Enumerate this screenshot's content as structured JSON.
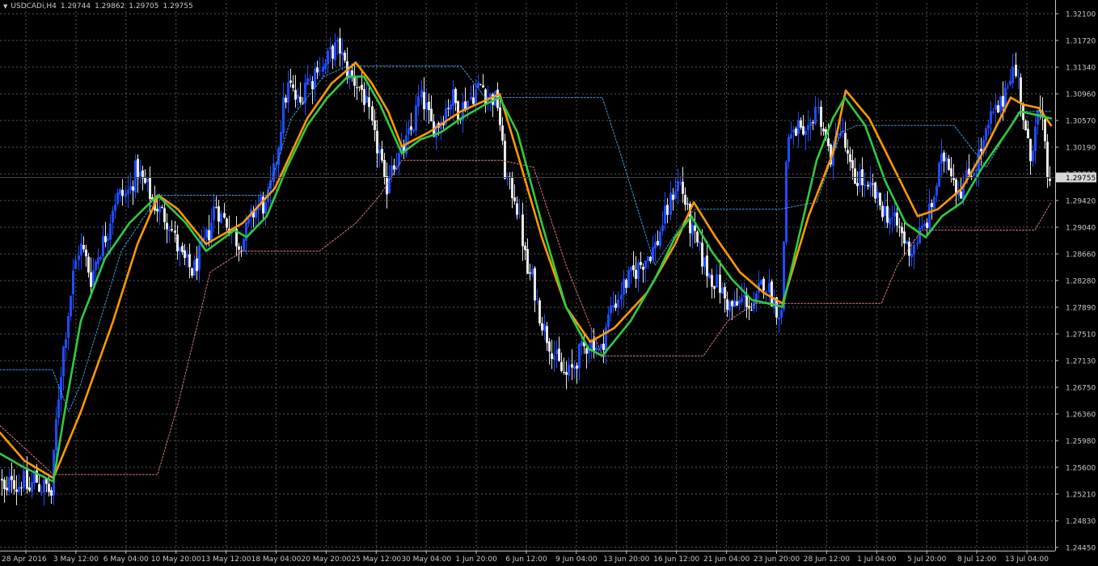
{
  "header": {
    "symbol": "USDCADi,H4",
    "open": "1.29744",
    "high": "1.29862",
    "low": "1.29705",
    "close": "1.29755"
  },
  "colors": {
    "background": "#000000",
    "axis": "#c8c8c8",
    "grid": "#5a5a5a",
    "bull_candle": "#1f4cff",
    "bear_candle": "#e8e8e8",
    "ma_fast": "#2ecc40",
    "ma_slow": "#ff9900",
    "upper_band": "#3aa0e6",
    "lower_band": "#e07878",
    "price_tag_bg": "#d9d9d9"
  },
  "chart_data": {
    "type": "candlestick",
    "price_axis": {
      "range": [
        1.2441,
        1.3225
      ],
      "ticks": [
        "1.32100",
        "1.31720",
        "1.31340",
        "1.30960",
        "1.30570",
        "1.30190",
        "1.29800",
        "1.29420",
        "1.29040",
        "1.28660",
        "1.28280",
        "1.27890",
        "1.27510",
        "1.27130",
        "1.26750",
        "1.26360",
        "1.25980",
        "1.25600",
        "1.25210",
        "1.24830",
        "1.24450"
      ]
    },
    "time_axis": {
      "labels": [
        "28 Apr 2016",
        "3 May 12:00",
        "6 May 04:00",
        "10 May 20:00",
        "13 May 12:00",
        "18 May 04:00",
        "20 May 20:00",
        "25 May 12:00",
        "30 May 04:00",
        "1 Jun 20:00",
        "6 Jun 12:00",
        "9 Jun 04:00",
        "13 Jun 20:00",
        "16 Jun 12:00",
        "21 Jun 04:00",
        "23 Jun 20:00",
        "28 Jun 12:00",
        "1 Jul 04:00",
        "5 Jul 20:00",
        "8 Jul 12:00",
        "13 Jul 04:00"
      ]
    },
    "current_price": "1.29755",
    "close_path": [
      [
        0,
        1.2545
      ],
      [
        7,
        1.2515
      ],
      [
        14,
        1.2552
      ],
      [
        21,
        1.253
      ],
      [
        28,
        1.2545
      ],
      [
        35,
        1.2524
      ],
      [
        42,
        1.2548
      ],
      [
        49,
        1.253
      ],
      [
        56,
        1.2535
      ],
      [
        63,
        1.252
      ],
      [
        70,
        1.264
      ],
      [
        77,
        1.272
      ],
      [
        84,
        1.278
      ],
      [
        91,
        1.284
      ],
      [
        98,
        1.288
      ],
      [
        105,
        1.286
      ],
      [
        112,
        1.283
      ],
      [
        119,
        1.286
      ],
      [
        126,
        1.288
      ],
      [
        133,
        1.29
      ],
      [
        140,
        1.294
      ],
      [
        147,
        1.295
      ],
      [
        154,
        1.295
      ],
      [
        161,
        1.296
      ],
      [
        168,
        1.299
      ],
      [
        175,
        1.297
      ],
      [
        182,
        1.296
      ],
      [
        189,
        1.294
      ],
      [
        196,
        1.293
      ],
      [
        203,
        1.292
      ],
      [
        210,
        1.291
      ],
      [
        217,
        1.288
      ],
      [
        224,
        1.286
      ],
      [
        231,
        1.285
      ],
      [
        238,
        1.284
      ],
      [
        245,
        1.286
      ],
      [
        252,
        1.288
      ],
      [
        259,
        1.29
      ],
      [
        266,
        1.294
      ],
      [
        273,
        1.292
      ],
      [
        280,
        1.291
      ],
      [
        287,
        1.29
      ],
      [
        294,
        1.288
      ],
      [
        301,
        1.289
      ],
      [
        308,
        1.291
      ],
      [
        315,
        1.293
      ],
      [
        322,
        1.294
      ],
      [
        329,
        1.293
      ],
      [
        336,
        1.297
      ],
      [
        343,
        1.302
      ],
      [
        350,
        1.308
      ],
      [
        357,
        1.311
      ],
      [
        364,
        1.309
      ],
      [
        371,
        1.308
      ],
      [
        378,
        1.312
      ],
      [
        385,
        1.311
      ],
      [
        392,
        1.314
      ],
      [
        399,
        1.313
      ],
      [
        406,
        1.315
      ],
      [
        413,
        1.316
      ],
      [
        420,
        1.316
      ],
      [
        427,
        1.313
      ],
      [
        434,
        1.312
      ],
      [
        441,
        1.311
      ],
      [
        448,
        1.31
      ],
      [
        455,
        1.307
      ],
      [
        462,
        1.303
      ],
      [
        469,
        1.301
      ],
      [
        476,
        1.295
      ],
      [
        483,
        1.3
      ],
      [
        490,
        1.3
      ],
      [
        497,
        1.301
      ],
      [
        504,
        1.303
      ],
      [
        511,
        1.305
      ],
      [
        518,
        1.309
      ],
      [
        525,
        1.308
      ],
      [
        532,
        1.305
      ],
      [
        539,
        1.305
      ],
      [
        546,
        1.306
      ],
      [
        553,
        1.308
      ],
      [
        560,
        1.309
      ],
      [
        567,
        1.307
      ],
      [
        574,
        1.308
      ],
      [
        581,
        1.309
      ],
      [
        588,
        1.31
      ],
      [
        595,
        1.311
      ],
      [
        602,
        1.309
      ],
      [
        609,
        1.309
      ],
      [
        616,
        1.308
      ],
      [
        623,
        1.299
      ],
      [
        630,
        1.296
      ],
      [
        637,
        1.295
      ],
      [
        644,
        1.29
      ],
      [
        651,
        1.284
      ],
      [
        658,
        1.283
      ],
      [
        665,
        1.279
      ],
      [
        672,
        1.276
      ],
      [
        679,
        1.274
      ],
      [
        686,
        1.272
      ],
      [
        693,
        1.27
      ],
      [
        700,
        1.269
      ],
      [
        707,
        1.27
      ],
      [
        714,
        1.272
      ],
      [
        721,
        1.273
      ],
      [
        728,
        1.274
      ],
      [
        735,
        1.274
      ],
      [
        742,
        1.272
      ],
      [
        749,
        1.276
      ],
      [
        756,
        1.279
      ],
      [
        763,
        1.28
      ],
      [
        770,
        1.282
      ],
      [
        777,
        1.283
      ],
      [
        784,
        1.284
      ],
      [
        791,
        1.285
      ],
      [
        798,
        1.286
      ],
      [
        805,
        1.287
      ],
      [
        812,
        1.288
      ],
      [
        819,
        1.291
      ],
      [
        826,
        1.293
      ],
      [
        833,
        1.296
      ],
      [
        840,
        1.297
      ],
      [
        847,
        1.294
      ],
      [
        854,
        1.29
      ],
      [
        861,
        1.288
      ],
      [
        868,
        1.286
      ],
      [
        875,
        1.284
      ],
      [
        882,
        1.283
      ],
      [
        889,
        1.282
      ],
      [
        896,
        1.28
      ],
      [
        903,
        1.279
      ],
      [
        910,
        1.279
      ],
      [
        917,
        1.28
      ],
      [
        924,
        1.28
      ],
      [
        931,
        1.278
      ],
      [
        938,
        1.281
      ],
      [
        945,
        1.283
      ],
      [
        952,
        1.281
      ],
      [
        959,
        1.279
      ],
      [
        966,
        1.278
      ],
      [
        973,
        1.304
      ],
      [
        980,
        1.303
      ],
      [
        987,
        1.305
      ],
      [
        994,
        1.302
      ],
      [
        1001,
        1.304
      ],
      [
        1008,
        1.308
      ],
      [
        1015,
        1.306
      ],
      [
        1022,
        1.302
      ],
      [
        1029,
        1.3
      ],
      [
        1036,
        1.305
      ],
      [
        1043,
        1.303
      ],
      [
        1050,
        1.299
      ],
      [
        1057,
        1.297
      ],
      [
        1064,
        1.298
      ],
      [
        1071,
        1.295
      ],
      [
        1078,
        1.296
      ],
      [
        1085,
        1.294
      ],
      [
        1092,
        1.293
      ],
      [
        1099,
        1.292
      ],
      [
        1106,
        1.291
      ],
      [
        1113,
        1.29
      ],
      [
        1120,
        1.288
      ],
      [
        1127,
        1.287
      ],
      [
        1134,
        1.289
      ],
      [
        1141,
        1.29
      ],
      [
        1148,
        1.292
      ],
      [
        1155,
        1.295
      ],
      [
        1162,
        1.299
      ],
      [
        1169,
        1.301
      ],
      [
        1176,
        1.299
      ],
      [
        1183,
        1.296
      ],
      [
        1190,
        1.296
      ],
      [
        1197,
        1.298
      ],
      [
        1204,
        1.299
      ],
      [
        1211,
        1.301
      ],
      [
        1218,
        1.303
      ],
      [
        1225,
        1.306
      ],
      [
        1232,
        1.307
      ],
      [
        1239,
        1.308
      ],
      [
        1246,
        1.312
      ],
      [
        1253,
        1.313
      ],
      [
        1260,
        1.311
      ],
      [
        1267,
        1.304
      ],
      [
        1274,
        1.3
      ],
      [
        1281,
        1.307
      ],
      [
        1288,
        1.306
      ],
      [
        1295,
        1.298
      ],
      [
        1300,
        1.2976
      ]
    ],
    "ma_fast": [
      [
        0,
        1.258
      ],
      [
        30,
        1.256
      ],
      [
        66,
        1.254
      ],
      [
        80,
        1.264
      ],
      [
        100,
        1.277
      ],
      [
        130,
        1.286
      ],
      [
        160,
        1.291
      ],
      [
        195,
        1.295
      ],
      [
        230,
        1.291
      ],
      [
        255,
        1.287
      ],
      [
        290,
        1.29
      ],
      [
        305,
        1.289
      ],
      [
        330,
        1.292
      ],
      [
        355,
        1.299
      ],
      [
        380,
        1.305
      ],
      [
        405,
        1.309
      ],
      [
        430,
        1.312
      ],
      [
        450,
        1.312
      ],
      [
        470,
        1.308
      ],
      [
        497,
        1.301
      ],
      [
        520,
        1.303
      ],
      [
        545,
        1.304
      ],
      [
        570,
        1.306
      ],
      [
        600,
        1.308
      ],
      [
        618,
        1.309
      ],
      [
        640,
        1.304
      ],
      [
        670,
        1.291
      ],
      [
        700,
        1.279
      ],
      [
        728,
        1.273
      ],
      [
        745,
        1.272
      ],
      [
        780,
        1.277
      ],
      [
        810,
        1.283
      ],
      [
        835,
        1.289
      ],
      [
        855,
        1.292
      ],
      [
        880,
        1.287
      ],
      [
        905,
        1.283
      ],
      [
        930,
        1.28
      ],
      [
        950,
        1.2795
      ],
      [
        968,
        1.279
      ],
      [
        990,
        1.29
      ],
      [
        1010,
        1.3
      ],
      [
        1030,
        1.306
      ],
      [
        1045,
        1.309
      ],
      [
        1070,
        1.305
      ],
      [
        1095,
        1.297
      ],
      [
        1120,
        1.291
      ],
      [
        1145,
        1.289
      ],
      [
        1165,
        1.292
      ],
      [
        1190,
        1.294
      ],
      [
        1215,
        1.299
      ],
      [
        1245,
        1.304
      ],
      [
        1262,
        1.307
      ],
      [
        1282,
        1.3065
      ],
      [
        1300,
        1.306
      ]
    ],
    "ma_slow": [
      [
        0,
        1.261
      ],
      [
        30,
        1.257
      ],
      [
        66,
        1.2545
      ],
      [
        100,
        1.264
      ],
      [
        140,
        1.277
      ],
      [
        170,
        1.288
      ],
      [
        196,
        1.295
      ],
      [
        220,
        1.293
      ],
      [
        255,
        1.288
      ],
      [
        300,
        1.291
      ],
      [
        340,
        1.296
      ],
      [
        380,
        1.306
      ],
      [
        410,
        1.311
      ],
      [
        440,
        1.314
      ],
      [
        460,
        1.311
      ],
      [
        480,
        1.307
      ],
      [
        497,
        1.302
      ],
      [
        530,
        1.304
      ],
      [
        570,
        1.307
      ],
      [
        618,
        1.3095
      ],
      [
        640,
        1.301
      ],
      [
        670,
        1.289
      ],
      [
        700,
        1.279
      ],
      [
        730,
        1.274
      ],
      [
        760,
        1.276
      ],
      [
        800,
        1.281
      ],
      [
        835,
        1.288
      ],
      [
        858,
        1.294
      ],
      [
        885,
        1.289
      ],
      [
        915,
        1.284
      ],
      [
        945,
        1.281
      ],
      [
        968,
        1.2795
      ],
      [
        1000,
        1.292
      ],
      [
        1030,
        1.301
      ],
      [
        1046,
        1.31
      ],
      [
        1075,
        1.306
      ],
      [
        1105,
        1.299
      ],
      [
        1135,
        1.292
      ],
      [
        1160,
        1.293
      ],
      [
        1190,
        1.296
      ],
      [
        1220,
        1.302
      ],
      [
        1250,
        1.309
      ],
      [
        1265,
        1.308
      ],
      [
        1285,
        1.3075
      ],
      [
        1300,
        1.305
      ]
    ],
    "upper_band": [
      [
        0,
        1.27
      ],
      [
        65,
        1.27
      ],
      [
        85,
        1.264
      ],
      [
        100,
        1.268
      ],
      [
        150,
        1.287
      ],
      [
        196,
        1.295
      ],
      [
        330,
        1.295
      ],
      [
        360,
        1.306
      ],
      [
        400,
        1.312
      ],
      [
        430,
        1.3135
      ],
      [
        570,
        1.3135
      ],
      [
        600,
        1.309
      ],
      [
        620,
        1.309
      ],
      [
        745,
        1.309
      ],
      [
        770,
        1.3
      ],
      [
        810,
        1.285
      ],
      [
        850,
        1.292
      ],
      [
        860,
        1.293
      ],
      [
        965,
        1.293
      ],
      [
        1010,
        1.294
      ],
      [
        1040,
        1.304
      ],
      [
        1060,
        1.305
      ],
      [
        1180,
        1.305
      ],
      [
        1220,
        1.299
      ],
      [
        1260,
        1.307
      ],
      [
        1300,
        1.307
      ]
    ],
    "lower_band": [
      [
        0,
        1.262
      ],
      [
        66,
        1.255
      ],
      [
        195,
        1.255
      ],
      [
        220,
        1.265
      ],
      [
        260,
        1.284
      ],
      [
        300,
        1.287
      ],
      [
        395,
        1.287
      ],
      [
        440,
        1.291
      ],
      [
        470,
        1.295
      ],
      [
        497,
        1.3
      ],
      [
        620,
        1.3
      ],
      [
        660,
        1.299
      ],
      [
        700,
        1.285
      ],
      [
        745,
        1.272
      ],
      [
        870,
        1.272
      ],
      [
        900,
        1.277
      ],
      [
        935,
        1.2795
      ],
      [
        1090,
        1.2795
      ],
      [
        1110,
        1.285
      ],
      [
        1140,
        1.29
      ],
      [
        1280,
        1.29
      ],
      [
        1300,
        1.294
      ]
    ]
  }
}
